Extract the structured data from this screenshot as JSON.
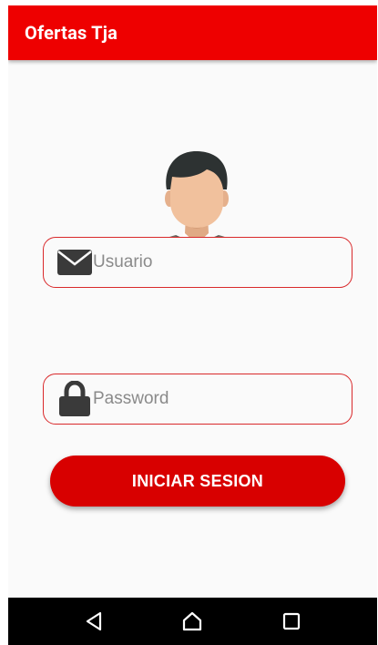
{
  "app_bar": {
    "title": "Ofertas Tja",
    "color": "#ee0000"
  },
  "avatar": {
    "icon": "user-avatar-icon"
  },
  "login_form": {
    "username": {
      "placeholder": "Usuario",
      "value": "",
      "icon": "mail-icon"
    },
    "password": {
      "placeholder": "Password",
      "value": "",
      "icon": "lock-icon"
    },
    "submit_label": "INICIAR SESION",
    "accent_color": "#d80000"
  },
  "nav_bar": {
    "buttons": [
      "back-icon",
      "home-icon",
      "recents-icon"
    ]
  }
}
